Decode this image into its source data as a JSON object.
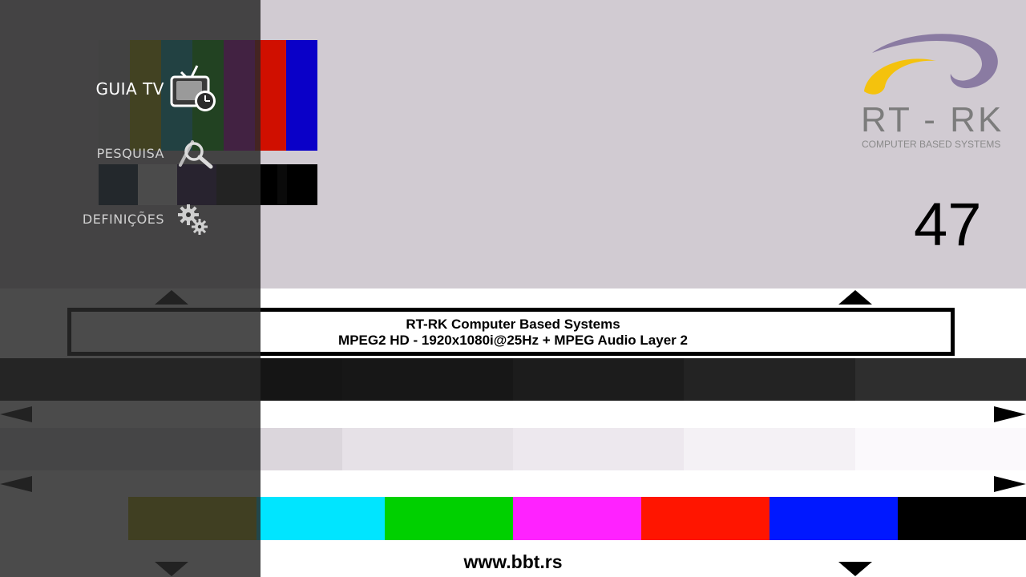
{
  "channel": {
    "number": "47"
  },
  "logo": {
    "brand": "RT - RK",
    "tagline": "COMPUTER BASED SYSTEMS"
  },
  "test_card": {
    "line1": "RT-RK Computer Based Systems",
    "line2": "MPEG2 HD - 1920x1080i@25Hz + MPEG Audio Layer 2",
    "url": "www.bbt.rs",
    "colors": {
      "top_bars": [
        "#c8c8c8",
        "#c9c500",
        "#00c3c8",
        "#00c400",
        "#c800c8",
        "#d00f00",
        "#0a00c8"
      ],
      "color_bars": [
        "#b7b300",
        "#00e5ff",
        "#00d000",
        "#ff22ff",
        "#ff1500",
        "#0018ff",
        "#000000"
      ],
      "dark_steps": [
        "#151515",
        "#171717",
        "#1c1c1c",
        "#232323",
        "#2e2e2e"
      ],
      "light_steps": [
        "#dbd6dc",
        "#e6e1e7",
        "#ede8ee",
        "#f4f1f5",
        "#fbf9fc"
      ]
    }
  },
  "menu": {
    "items": [
      {
        "label": "GUIA TV",
        "icon": "tv-guide-icon",
        "active": true
      },
      {
        "label": "PESQUISA",
        "icon": "search-icon",
        "active": false
      },
      {
        "label": "DEFINIÇÕES",
        "icon": "settings-gears-icon",
        "active": false
      }
    ]
  }
}
